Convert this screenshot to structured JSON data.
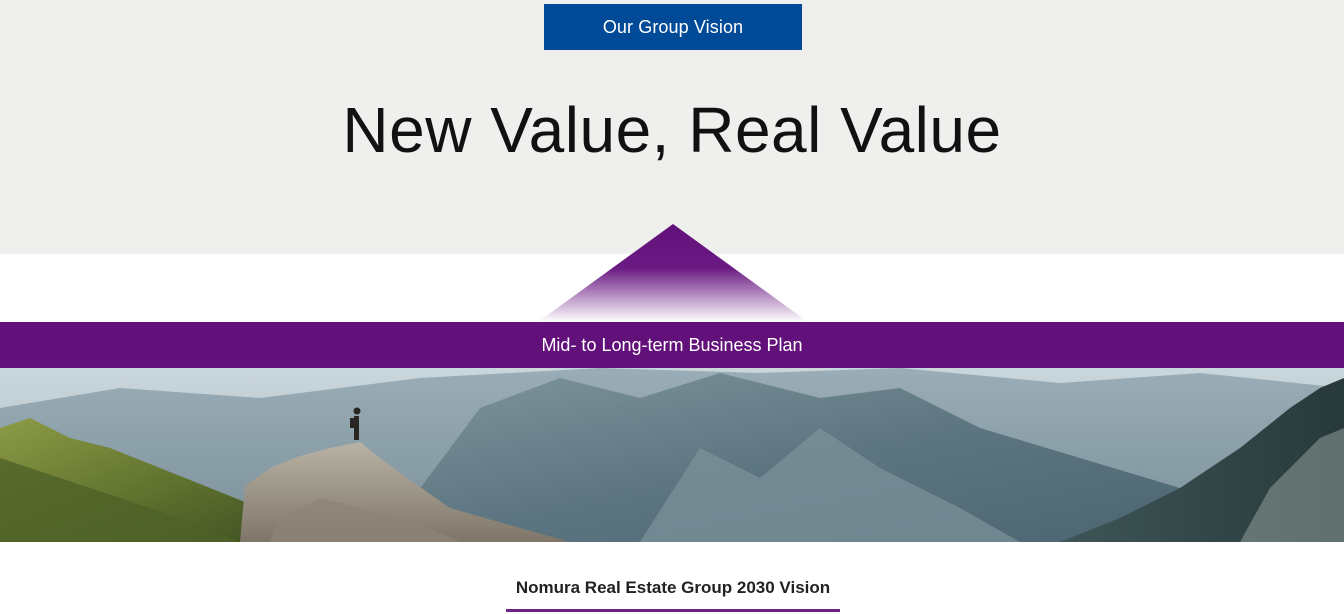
{
  "header": {
    "badge_label": "Our Group Vision",
    "title": "New Value, Real Value"
  },
  "plan_bar": {
    "label": "Mid- to Long-term Business Plan"
  },
  "hero": {
    "image_subject": "hiker standing on a rocky peak overlooking forested mountain valleys"
  },
  "section_tab": {
    "label": "Nomura Real Estate Group 2030 Vision"
  },
  "colors": {
    "badge_blue": "#004a97",
    "plan_purple": "#62107a",
    "top_band_gray": "#efefed",
    "underline_purple": "#6b2386"
  }
}
